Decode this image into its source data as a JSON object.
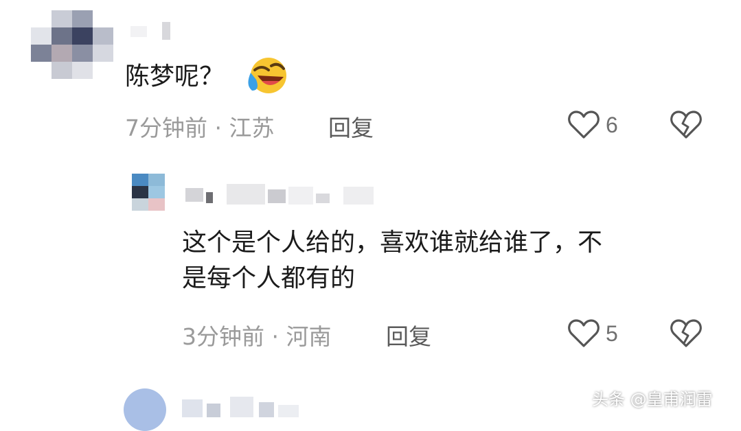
{
  "comments": [
    {
      "text": "陈梦呢？",
      "emoji": "laughing-crying-emoji",
      "time_location": "7分钟前 · 江苏",
      "reply_label": "回复",
      "like_count": "6"
    }
  ],
  "reply": {
    "text_line1": "这个是个人给的，喜欢谁就给谁了，不",
    "text_line2": "是每个人都有的",
    "time_location": "3分钟前 · 河南",
    "reply_label": "回复",
    "like_count": "5"
  },
  "watermark": "头条 @皇甫润雷",
  "colors": {
    "meta": "#9a9a9a",
    "text": "#1b1b1b",
    "icon": "#555555"
  }
}
